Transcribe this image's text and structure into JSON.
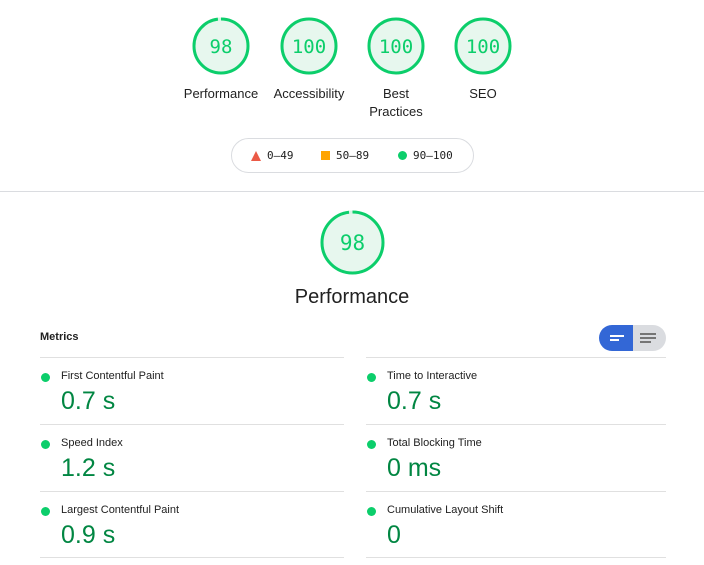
{
  "gauges": [
    {
      "score": "98",
      "label_lines": [
        "Performance"
      ],
      "fraction": 0.98
    },
    {
      "score": "100",
      "label_lines": [
        "Accessibility"
      ],
      "fraction": 1.0
    },
    {
      "score": "100",
      "label_lines": [
        "Best",
        "Practices"
      ],
      "fraction": 1.0
    },
    {
      "score": "100",
      "label_lines": [
        "SEO"
      ],
      "fraction": 1.0
    }
  ],
  "legend": {
    "fail": "0–49",
    "average": "50–89",
    "pass": "90–100"
  },
  "performance": {
    "score": "98",
    "fraction": 0.98,
    "title": "Performance"
  },
  "metrics": {
    "heading": "Metrics",
    "left": [
      {
        "title": "First Contentful Paint",
        "value": "0.7 s"
      },
      {
        "title": "Speed Index",
        "value": "1.2 s"
      },
      {
        "title": "Largest Contentful Paint",
        "value": "0.9 s"
      }
    ],
    "right": [
      {
        "title": "Time to Interactive",
        "value": "0.7 s"
      },
      {
        "title": "Total Blocking Time",
        "value": "0 ms"
      },
      {
        "title": "Cumulative Layout Shift",
        "value": "0"
      }
    ]
  },
  "colors": {
    "pass": "#0cce6b",
    "pass_text": "#018642",
    "average": "#ffa400",
    "fail": "#eb5a46",
    "toggle_active": "#3367d6"
  },
  "icons": {
    "toggle_compact": "lines-icon",
    "toggle_expanded": "list-icon"
  }
}
